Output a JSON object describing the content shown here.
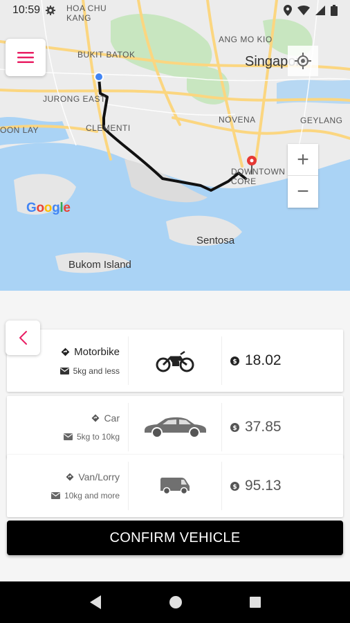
{
  "status_bar": {
    "time": "10:59"
  },
  "map": {
    "labels": {
      "hoa_chu_kang": "HOA CHU\nKANG",
      "bukit_batok": "BUKIT BATOK",
      "ang_mo_kio": "ANG MO KIO",
      "singapore": "Singapore",
      "jurong_east": "JURONG EAST",
      "novena": "NOVENA",
      "geylang": "GEYLANG",
      "clementi": "CLEMENTI",
      "joon_lay": "OON LAY",
      "downtown_core": "DOWNTOWN\nCORE",
      "sentosa": "Sentosa",
      "bukom_island": "Bukom Island"
    },
    "attribution": "Google",
    "zoom_in": "+",
    "zoom_out": "−"
  },
  "vehicles": [
    {
      "name": "Motorbike",
      "weight": "5kg and less",
      "price": "18.02",
      "icon": "motorbike-icon"
    },
    {
      "name": "Car",
      "weight": "5kg to 10kg",
      "price": "37.85",
      "icon": "car-icon"
    },
    {
      "name": "Van/Lorry",
      "weight": "10kg and more",
      "price": "95.13",
      "icon": "van-icon"
    }
  ],
  "confirm_label": "CONFIRM VEHICLE",
  "colors": {
    "accent": "#e91e63",
    "route": "#111111",
    "water": "#aad3f5",
    "land": "#eeeeee",
    "park": "#c8e6c0",
    "road": "#fbd680"
  }
}
